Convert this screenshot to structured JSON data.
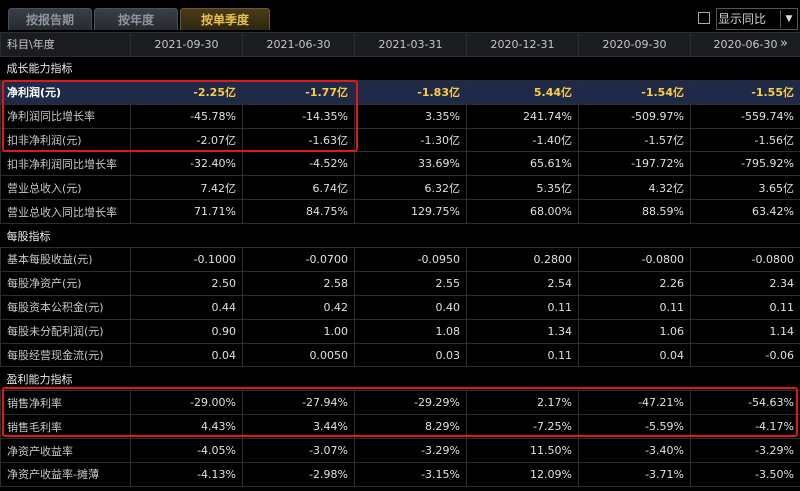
{
  "tabs": [
    "按报告期",
    "按年度",
    "按单季度"
  ],
  "toggle_label": "显示同比",
  "dropdown_arrow": "▼",
  "expand_glyph": "»",
  "header": [
    "科目\\年度",
    "2021-09-30",
    "2021-06-30",
    "2021-03-31",
    "2020-12-31",
    "2020-09-30",
    "2020-06-30"
  ],
  "rows": [
    {
      "type": "section",
      "label": "成长能力指标"
    },
    {
      "type": "row",
      "label": "净利润(元)",
      "values": [
        "-2.25亿",
        "-1.77亿",
        "-1.83亿",
        "5.44亿",
        "-1.54亿",
        "-1.55亿"
      ],
      "selected": true
    },
    {
      "type": "row",
      "label": "净利润同比增长率",
      "values": [
        "-45.78%",
        "-14.35%",
        "3.35%",
        "241.74%",
        "-509.97%",
        "-559.74%"
      ]
    },
    {
      "type": "row",
      "label": "扣非净利润(元)",
      "values": [
        "-2.07亿",
        "-1.63亿",
        "-1.30亿",
        "-1.40亿",
        "-1.57亿",
        "-1.56亿"
      ]
    },
    {
      "type": "row",
      "label": "扣非净利润同比增长率",
      "values": [
        "-32.40%",
        "-4.52%",
        "33.69%",
        "65.61%",
        "-197.72%",
        "-795.92%"
      ]
    },
    {
      "type": "row",
      "label": "营业总收入(元)",
      "values": [
        "7.42亿",
        "6.74亿",
        "6.32亿",
        "5.35亿",
        "4.32亿",
        "3.65亿"
      ]
    },
    {
      "type": "row",
      "label": "营业总收入同比增长率",
      "values": [
        "71.71%",
        "84.75%",
        "129.75%",
        "68.00%",
        "88.59%",
        "63.42%"
      ]
    },
    {
      "type": "section",
      "label": "每股指标"
    },
    {
      "type": "row",
      "label": "基本每股收益(元)",
      "values": [
        "-0.1000",
        "-0.0700",
        "-0.0950",
        "0.2800",
        "-0.0800",
        "-0.0800"
      ]
    },
    {
      "type": "row",
      "label": "每股净资产(元)",
      "values": [
        "2.50",
        "2.58",
        "2.55",
        "2.54",
        "2.26",
        "2.34"
      ]
    },
    {
      "type": "row",
      "label": "每股资本公积金(元)",
      "values": [
        "0.44",
        "0.42",
        "0.40",
        "0.11",
        "0.11",
        "0.11"
      ]
    },
    {
      "type": "row",
      "label": "每股未分配利润(元)",
      "values": [
        "0.90",
        "1.00",
        "1.08",
        "1.34",
        "1.06",
        "1.14"
      ]
    },
    {
      "type": "row",
      "label": "每股经营现金流(元)",
      "values": [
        "0.04",
        "0.0050",
        "0.03",
        "0.11",
        "0.04",
        "-0.06"
      ]
    },
    {
      "type": "section",
      "label": "盈利能力指标"
    },
    {
      "type": "row",
      "label": "销售净利率",
      "values": [
        "-29.00%",
        "-27.94%",
        "-29.29%",
        "2.17%",
        "-47.21%",
        "-54.63%"
      ]
    },
    {
      "type": "row",
      "label": "销售毛利率",
      "values": [
        "4.43%",
        "3.44%",
        "8.29%",
        "-7.25%",
        "-5.59%",
        "-4.17%"
      ]
    },
    {
      "type": "row",
      "label": "净资产收益率",
      "values": [
        "-4.05%",
        "-3.07%",
        "-3.29%",
        "11.50%",
        "-3.40%",
        "-3.29%"
      ]
    },
    {
      "type": "row",
      "label": "净资产收益率-摊薄",
      "values": [
        "-4.13%",
        "-2.98%",
        "-3.15%",
        "12.09%",
        "-3.71%",
        "-3.50%"
      ]
    }
  ]
}
